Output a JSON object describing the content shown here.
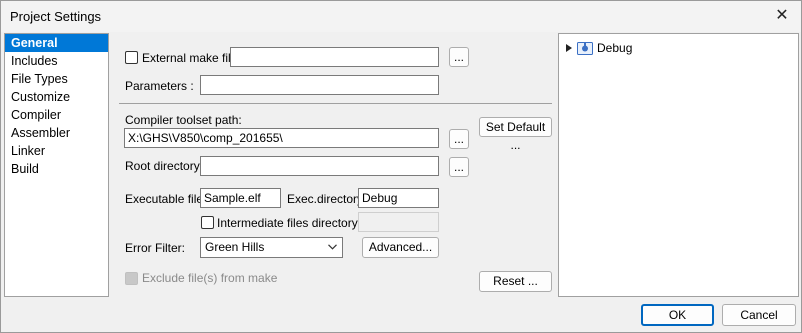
{
  "window": {
    "title": "Project Settings"
  },
  "sidebar": {
    "items": [
      {
        "label": "General",
        "selected": true
      },
      {
        "label": "Includes"
      },
      {
        "label": "File Types"
      },
      {
        "label": "Customize"
      },
      {
        "label": "Compiler"
      },
      {
        "label": "Assembler"
      },
      {
        "label": "Linker"
      },
      {
        "label": "Build"
      }
    ]
  },
  "general": {
    "external_make": {
      "label": "External make file",
      "value": "",
      "browse": "..."
    },
    "parameters": {
      "label": "Parameters :",
      "value": ""
    },
    "compiler_toolset": {
      "label": "Compiler toolset path:",
      "value": "X:\\GHS\\V850\\comp_201655\\",
      "browse": "...",
      "set_default": "Set Default ..."
    },
    "root_directory": {
      "label": "Root directory:",
      "value": "",
      "browse": "..."
    },
    "executable": {
      "label": "Executable file",
      "value": "Sample.elf"
    },
    "exec_directory": {
      "label": "Exec.directory",
      "value": "Debug"
    },
    "intermediate": {
      "label": "Intermediate files directory",
      "value": ""
    },
    "error_filter": {
      "label": "Error Filter:",
      "value": "Green Hills",
      "advanced": "Advanced..."
    },
    "exclude": {
      "label": "Exclude file(s) from make"
    },
    "reset": "Reset ..."
  },
  "tree": {
    "root": "Debug"
  },
  "footer": {
    "ok": "OK",
    "cancel": "Cancel"
  },
  "colors": {
    "selection": "#0078d7",
    "ok_border": "#0067c0"
  }
}
